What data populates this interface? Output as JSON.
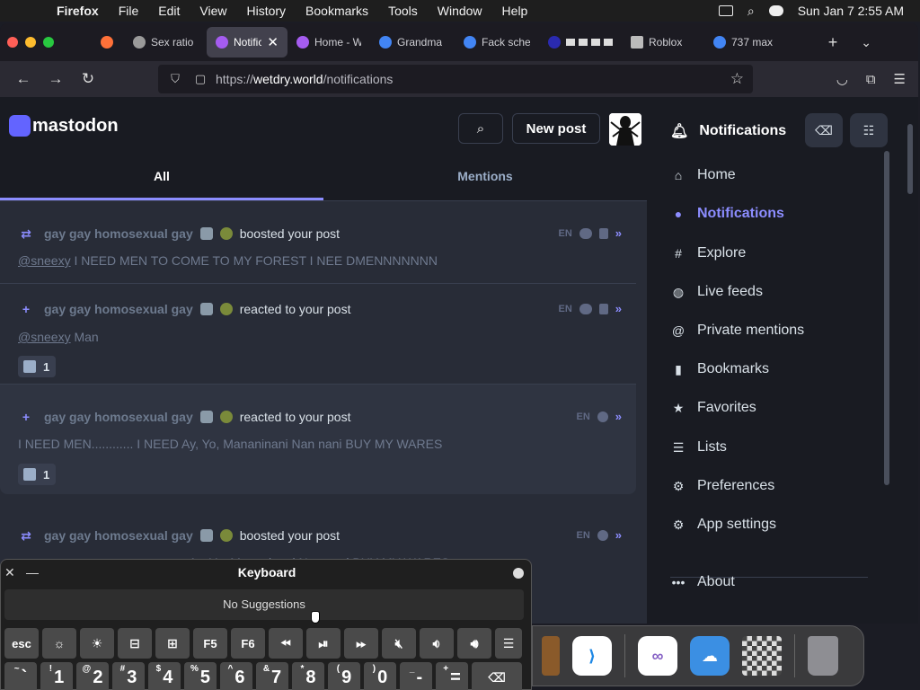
{
  "menubar": {
    "app": "Firefox",
    "items": [
      "File",
      "Edit",
      "View",
      "History",
      "Bookmarks",
      "Tools",
      "Window",
      "Help"
    ],
    "datetime": "Sun Jan 7  2:55 AM"
  },
  "browser": {
    "tabs": [
      {
        "title": "Sex ratio",
        "icon": "wiki-icon",
        "color": "#9a9a9a"
      },
      {
        "title": "Notific",
        "icon": "mastodon-favicon",
        "color": "#a55cf0",
        "active": true
      },
      {
        "title": "Home - W",
        "icon": "mastodon-favicon",
        "color": "#a55cf0"
      },
      {
        "title": "Grandma",
        "icon": "google-icon",
        "color": "#4285f4"
      },
      {
        "title": "Fack sche",
        "icon": "google-icon",
        "color": "#4285f4"
      },
      {
        "title": "",
        "icon": "blue-favicon",
        "color": "#2a2ab0"
      },
      {
        "title": "Roblox",
        "icon": "roblox-icon",
        "color": "#bbbbbb"
      },
      {
        "title": "737 max",
        "icon": "google-icon",
        "color": "#4285f4"
      }
    ],
    "url_prefix": "https://",
    "url_domain": "wetdry.world",
    "url_path": "/notifications"
  },
  "mastodon": {
    "logo_text": "mastodon",
    "new_post": "New post",
    "tabs": [
      "All",
      "Mentions"
    ],
    "notifications": [
      {
        "kind": "boost",
        "who": "gay gay homosexual gay",
        "action": "boosted your post",
        "lang": "EN",
        "body_mention": "@sneexy",
        "body": " I NEED MEN TO COME TO MY FOREST I NEE DMENNNNNNN"
      },
      {
        "kind": "reaction",
        "who": "gay gay homosexual gay",
        "action": "reacted to your post",
        "lang": "EN",
        "body_mention": "@sneexy",
        "body": " Man",
        "count": "1"
      },
      {
        "kind": "reaction",
        "who": "gay gay homosexual gay",
        "action": "reacted to your post",
        "lang": "EN",
        "body_mention": "",
        "body": "I NEED MEN............ I NEED  Ay, Yo, Mananinani Nan nani BUY MY WARES",
        "count": "1"
      },
      {
        "kind": "boost",
        "who": "gay gay homosexual gay",
        "action": "boosted your post",
        "lang": "EN",
        "body_mention": "",
        "body": "Ay, Yo, Mananinani Nan nani BUY MY WARES"
      }
    ],
    "nav_header": "Notifications",
    "nav": [
      "Home",
      "Notifications",
      "Explore",
      "Live feeds",
      "Private mentions",
      "Bookmarks",
      "Favorites",
      "Lists",
      "Preferences",
      "App settings",
      "About"
    ]
  },
  "keyboard": {
    "title": "Keyboard",
    "suggestions": "No Suggestions",
    "fn_row": [
      "esc",
      "",
      "",
      "",
      "",
      "F5",
      "F6",
      "",
      "",
      "",
      "",
      "",
      "",
      ""
    ],
    "num_row": [
      {
        "sup": "~",
        "main": "`"
      },
      {
        "sup": "!",
        "main": "1"
      },
      {
        "sup": "@",
        "main": "2"
      },
      {
        "sup": "#",
        "main": "3"
      },
      {
        "sup": "$",
        "main": "4"
      },
      {
        "sup": "%",
        "main": "5"
      },
      {
        "sup": "^",
        "main": "6"
      },
      {
        "sup": "&",
        "main": "7"
      },
      {
        "sup": "*",
        "main": "8"
      },
      {
        "sup": "(",
        "main": "9"
      },
      {
        "sup": ")",
        "main": "0"
      },
      {
        "sup": "_",
        "main": "-"
      },
      {
        "sup": "+",
        "main": "="
      }
    ]
  },
  "colors": {
    "accent": "#8c8dff",
    "bg": "#191b22",
    "panel": "#282c37"
  }
}
